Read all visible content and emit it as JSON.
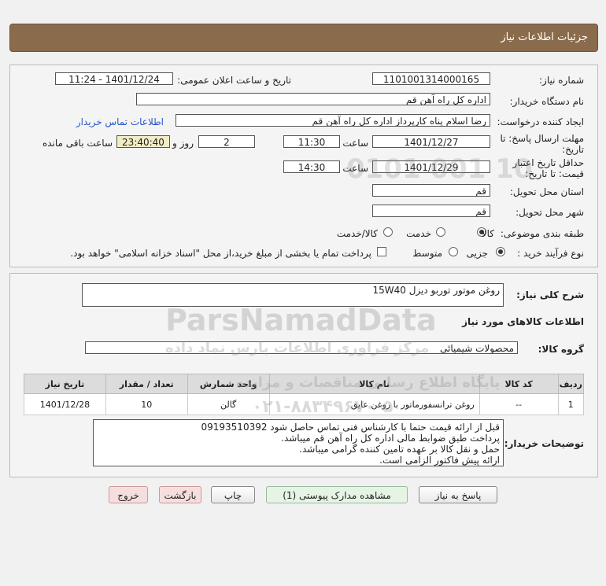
{
  "header": {
    "title": "جزئیات اطلاعات نیاز"
  },
  "form": {
    "need_number_label": "شماره نیاز:",
    "need_number": "1101001314000165",
    "announce_label": "تاریخ و ساعت اعلان عمومی:",
    "announce_value": "1401/12/24 - 11:24",
    "buyer_org_label": "نام دستگاه خریدار:",
    "buyer_org": "اداره کل  راه آهن قم",
    "creator_label": "ایجاد کننده درخواست:",
    "creator": "رضا اسلام پناه کارپرداز اداره کل  راه آهن قم",
    "contact_link": "اطلاعات تماس خریدار",
    "deadline_label_1": "مهلت ارسال پاسخ: تا",
    "deadline_label_2": "تاریخ:",
    "deadline_date": "1401/12/27",
    "time_label": "ساعت",
    "deadline_time": "11:30",
    "days_value": "2",
    "days_label": "روز و",
    "remaining_time": "23:40:40",
    "remaining_label": "ساعت باقی مانده",
    "validity_label_1": "حداقل تاریخ اعتبار",
    "validity_label_2": "قیمت: تا تاریخ:",
    "validity_date": "1401/12/29",
    "validity_time_label": "ساعت",
    "validity_time": "14:30",
    "province_label": "استان محل تحویل:",
    "province": "قم",
    "city_label": "شهر محل تحویل:",
    "city": "قم",
    "category_label": "طبقه بندی موضوعی:",
    "category_options": [
      "کالا",
      "خدمت",
      "کالا/خدمت"
    ],
    "process_label": "نوع فرآیند خرید :",
    "process_options": [
      "جزیی",
      "متوسط"
    ],
    "payment_note": "پرداخت تمام یا بخشی از مبلغ خرید،از محل \"اسناد خزانه اسلامی\" خواهد بود."
  },
  "details": {
    "general_desc_label": "شرح کلی نیاز:",
    "general_desc": "روغن موتور توربو دیزل 15W40",
    "goods_info_title": "اطلاعات کالاهای مورد نیاز",
    "goods_group_label": "گروه کالا:",
    "goods_group": "محصولات شیمیائی",
    "table": {
      "headers": [
        "ردیف",
        "کد کالا",
        "نام کالا",
        "واحد شمارش",
        "تعداد / مقدار",
        "تاریخ نیاز"
      ],
      "rows": [
        [
          "1",
          "--",
          "روغن ترانسفورماتور با روغن عایق",
          "گالن",
          "10",
          "1401/12/28"
        ]
      ]
    },
    "buyer_notes_label": "توضیحات خریدار:",
    "buyer_notes": [
      "قبل از ارائه قیمت حتما با کارشناس فنی تماس حاصل شود 09193510392",
      "پرداخت طبق ضوابط مالی اداره کل راه آهن قم میباشد.",
      "حمل و نقل کالا بر عهده تامین کننده گرامی میباشد.",
      "ارائه پیش فاکتور الزامی است."
    ]
  },
  "buttons": {
    "reply": "پاسخ به نیاز",
    "attachments": "مشاهده مدارک پیوستی (1)",
    "print": "چاپ",
    "back": "بازگشت",
    "exit": "خروج"
  },
  "watermark": {
    "main": "ParsNamadData",
    "fa_1": "مرکز فراوری اطلاعات پارس نماد داده",
    "fa_2": "پایگاه اطلاع رسانی مناقصات و مزایده",
    "phone": "۰۲۱-۸۸۳۴۹۶۷۰-۵",
    "digits": "0101 001 10"
  }
}
